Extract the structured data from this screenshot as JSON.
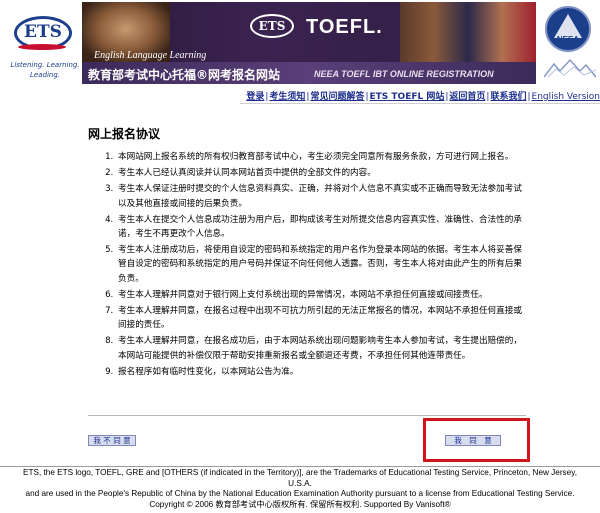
{
  "header": {
    "ets_logo": {
      "word": "ETS",
      "tagline_line1": "Listening. Learning.",
      "tagline_line2": "Leading."
    },
    "banner": {
      "ets_mark": "ETS",
      "toefl_word": "TOEFL.",
      "subtitle_en": "English Language Learning",
      "title_cn": "教育部考试中心托福®网考报名网站",
      "title_en": "NEEA TOEFL IBT ONLINE REGISTRATION"
    },
    "neea_logo": {
      "word": "NEEA"
    }
  },
  "nav": {
    "items": [
      {
        "label": "登录"
      },
      {
        "label": "考生须知"
      },
      {
        "label": "常见问题解答"
      },
      {
        "label": "ETS TOEFL 网站"
      },
      {
        "label": "返回首页"
      },
      {
        "label": "联系我们"
      },
      {
        "label": "English Version"
      }
    ]
  },
  "main": {
    "title": "网上报名协议",
    "agreement": [
      "本网站网上报名系统的所有权归教育部考试中心，考生必须完全同意所有服务条款，方可进行网上报名。",
      "考生本人已经认真阅读并认同本网站首页中提供的全部文件的内容。",
      "考生本人保证注册时提交的个人信息资料真实、正确，并将对个人信息不真实或不正确而导致无法参加考试以及其他直接或间接的后果负责。",
      "考生本人在提交个人信息成功注册为用户后，即构成该考生对所提交信息内容真实性、准确性、合法性的承诺，考生不再更改个人信息。",
      "考生本人注册成功后，将使用自设定的密码和系统指定的用户名作为登录本网站的依据。考生本人将妥善保管自设定的密码和系统指定的用户号码并保证不向任何他人透露。否则，考生本人将对由此产生的所有后果负责。",
      "考生本人理解并同意对于银行网上支付系统出现的异常情况，本网站不承担任何直接或间接责任。",
      "考生本人理解并同意，在报名过程中出现不可抗力所引起的无法正常报名的情况，本网站不承担任何直接或间接的责任。",
      "考生本人理解并同意，在报名成功后，由于本网站系统出现问题影响考生本人参加考试，考生提出赔偿的，本网站可能提供的补偿仅限于帮助安排重新报名或全额退还考费，不承担任何其他连带责任。",
      "报名程序如有临时性变化，以本网站公告为准。"
    ],
    "disagree_label": "我 不 同 意",
    "agree_label": "我　同　意"
  },
  "footer": {
    "line1": "ETS, the ETS logo, TOEFL, GRE and [OTHERS (if indicated in the Territory)], are the Trademarks of Educational Testing Service, Princeton, New Jersey,",
    "line2": "U.S.A.",
    "line3": "and are used in the People's Republic of China by the National Education Examination Authority pursuant to a license from Educational Testing Service.",
    "line4": "Copyright © 2006 教育部考试中心版权所有. 保留所有权利. Supported By Vanisoft®"
  },
  "colors": {
    "link": "#1e2f8e",
    "highlight": "#d0141c",
    "banner_dark": "#2a1a3a",
    "button_bg": "#d7dcef",
    "ets_blue": "#1c3f8c"
  }
}
